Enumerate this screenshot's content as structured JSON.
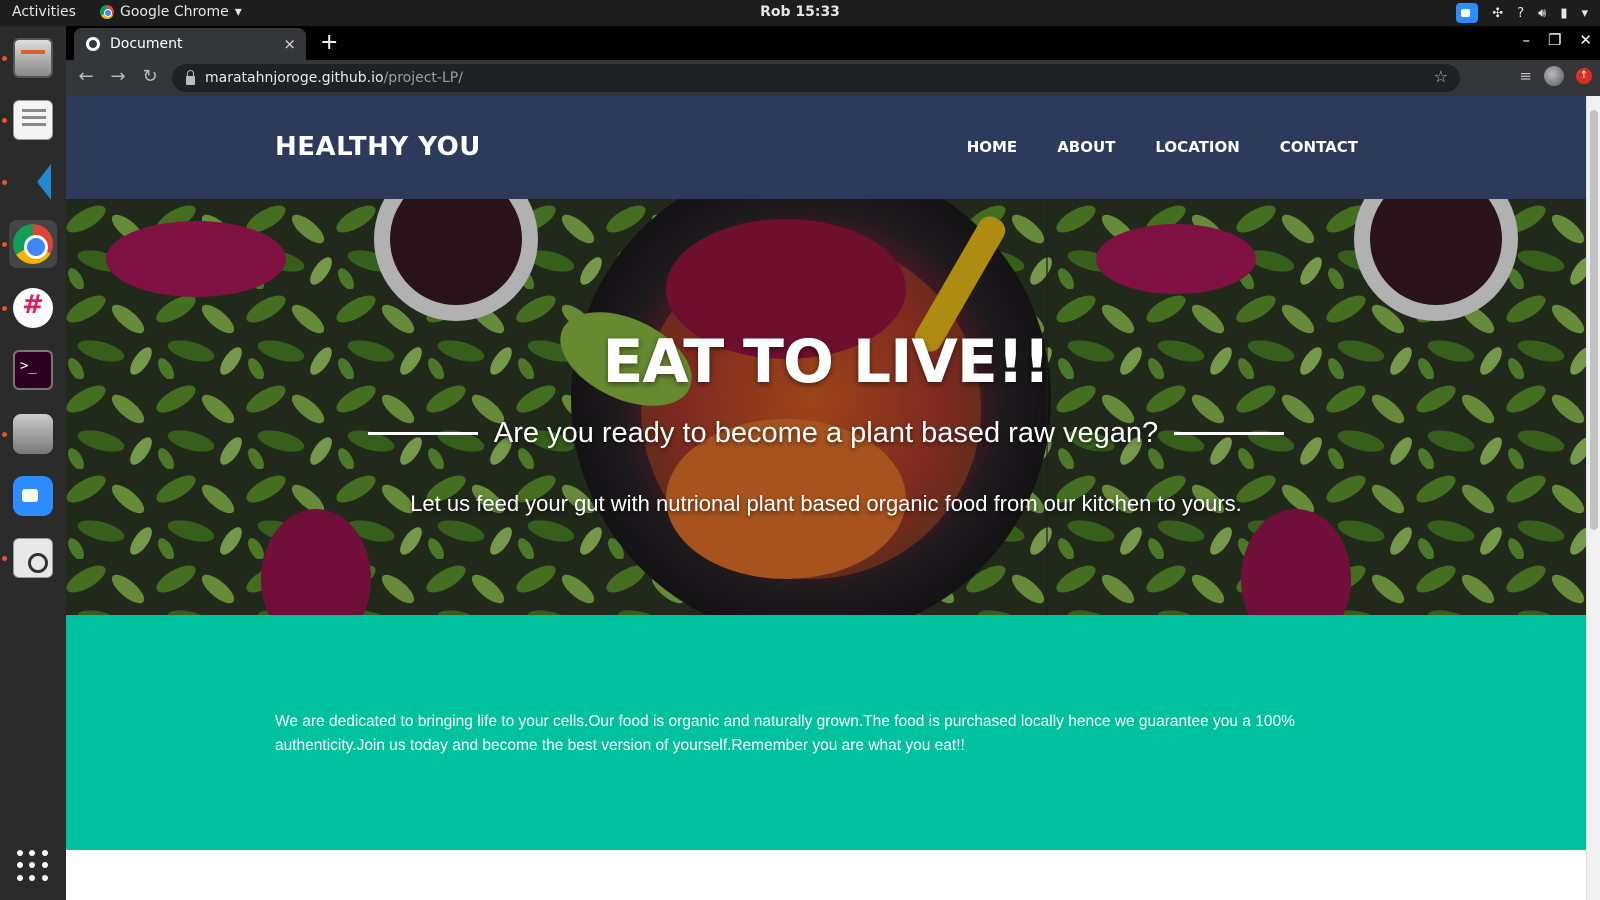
{
  "system": {
    "activities": "Activities",
    "app_menu": "Google Chrome",
    "clock": "Rob 15:33",
    "tray_help": "?"
  },
  "browser": {
    "tab_title": "Document",
    "tab_close": "×",
    "new_tab": "+",
    "url_host": "maratahnjoroge.github.io",
    "url_path": "/project-LP/"
  },
  "site": {
    "logo": "HEALTHY YOU",
    "nav": [
      "HOME",
      "ABOUT",
      "LOCATION",
      "CONTACT"
    ],
    "hero": {
      "title": "EAT TO LIVE!!",
      "subtitle": "Are you ready to become a plant based raw vegan?",
      "description": "Let us feed your gut with nutrional plant based organic food from our kitchen to yours."
    },
    "about": {
      "text": "We are dedicated to bringing life to your cells.Our food is organic and naturally grown.The food is purchased locally hence we guarantee you a 100% authenticity.Join us today and become the best version of yourself.Remember you are what you eat!!"
    }
  },
  "colors": {
    "header_bg": "#2c3a5b",
    "about_bg": "#00c19e"
  }
}
